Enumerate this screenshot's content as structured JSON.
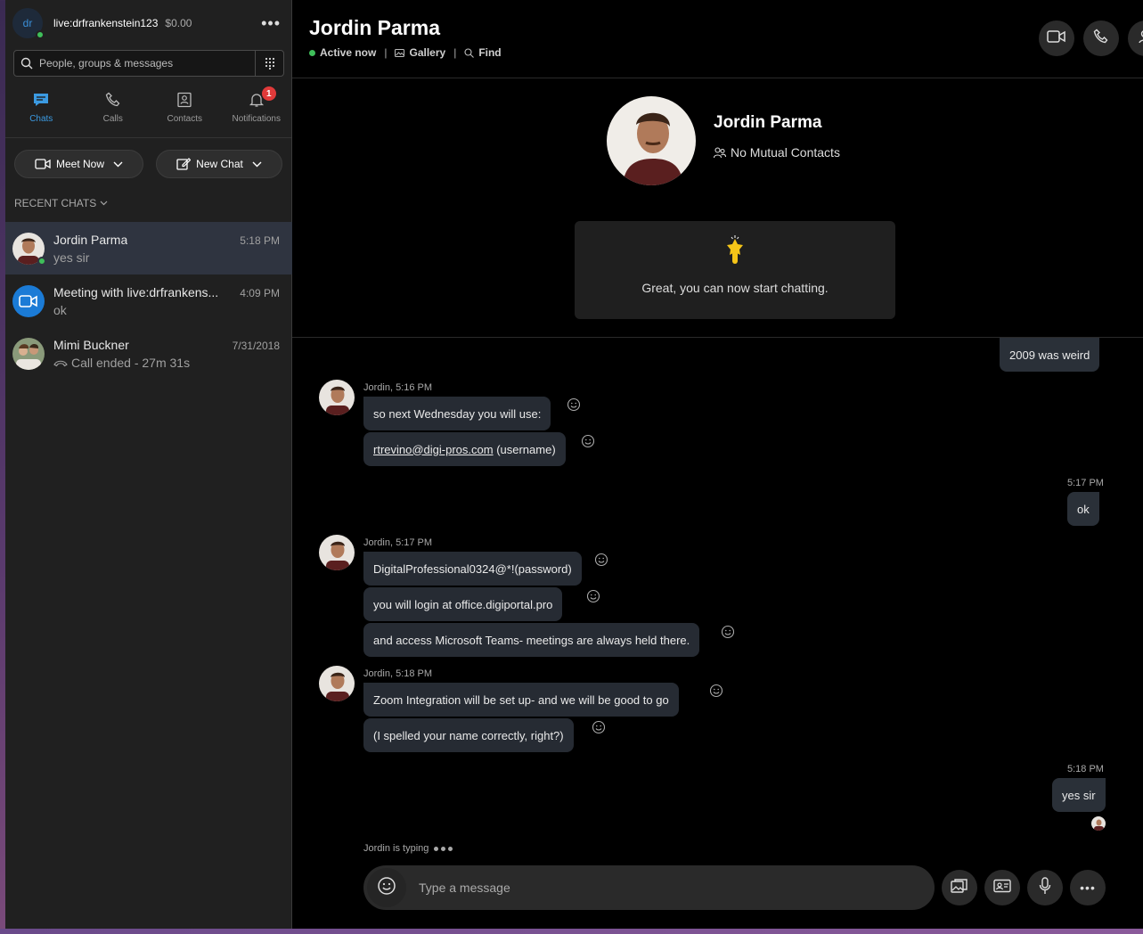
{
  "account": {
    "initials": "dr",
    "name": "live:drfrankenstein123",
    "balance": "$0.00"
  },
  "search": {
    "placeholder": "People, groups & messages"
  },
  "nav": {
    "tabs": [
      {
        "label": "Chats"
      },
      {
        "label": "Calls"
      },
      {
        "label": "Contacts"
      },
      {
        "label": "Notifications",
        "badge": "1"
      }
    ]
  },
  "actions": {
    "meet_now": "Meet Now",
    "new_chat": "New Chat"
  },
  "recent": {
    "header": "RECENT CHATS"
  },
  "chats": [
    {
      "name": "Jordin Parma",
      "time": "5:18 PM",
      "preview": "yes sir"
    },
    {
      "name": "Meeting with live:drfrankens...",
      "time": "4:09 PM",
      "preview": "ok"
    },
    {
      "name": "Mimi Buckner",
      "time": "7/31/2018",
      "preview": "Call ended - 27m 31s"
    }
  ],
  "header": {
    "title": "Jordin Parma",
    "status": "Active now",
    "gallery": "Gallery",
    "find": "Find"
  },
  "contact": {
    "name": "Jordin Parma",
    "mutual": "No Mutual Contacts"
  },
  "welcome": {
    "text": "Great, you can now start chatting."
  },
  "messages": {
    "m0": "2009 was weird",
    "g1_meta": "Jordin, 5:16 PM",
    "m1": "so next Wednesday you will use:",
    "m2_link": "rtrevino@digi-pros.com",
    "m2_rest": " (username)",
    "me1_time": "5:17 PM",
    "me1": "ok",
    "g2_meta": "Jordin, 5:17 PM",
    "m3": "DigitalProfessional0324@*!(password)",
    "m4": "you will login at office.digiportal.pro",
    "m5": "and access Microsoft Teams-  meetings are always held there.",
    "g3_meta": "Jordin, 5:18 PM",
    "m6": "Zoom Integration will be set up- and we will be good to go",
    "m7": "(I spelled your name correctly, right?)",
    "me2_time": "5:18 PM",
    "me2": "yes sir"
  },
  "typing": {
    "text": "Jordin is typing"
  },
  "composer": {
    "placeholder": "Type a message"
  },
  "colors": {
    "accent": "#3b9ae1",
    "online": "#3fbf5a",
    "badge": "#e03a3a",
    "bubble": "#262b33"
  }
}
